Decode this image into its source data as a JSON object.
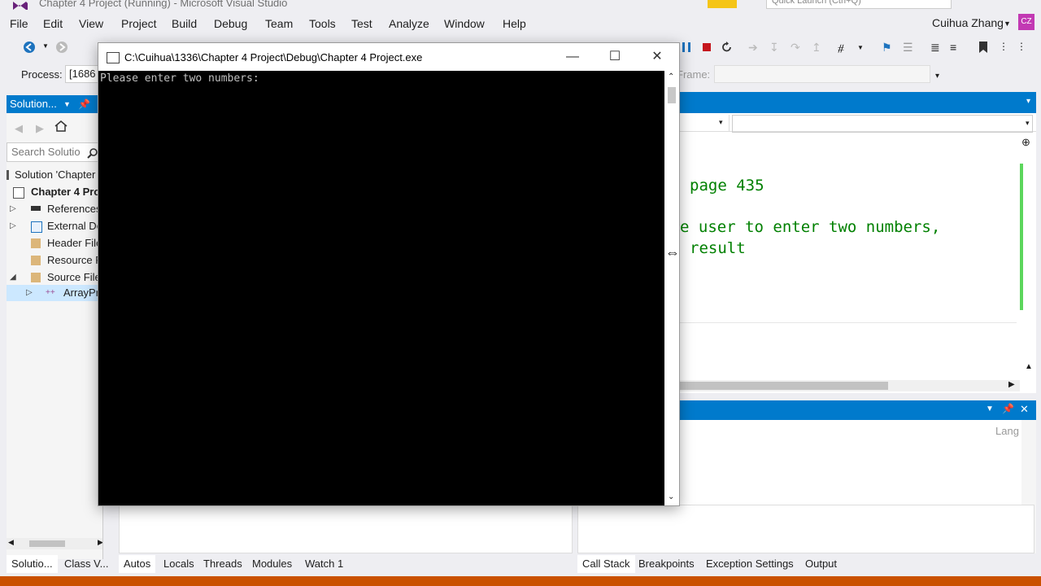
{
  "app": {
    "title": "Chapter 4 Project (Running) - Microsoft Visual Studio",
    "quick_launch_placeholder": "Quick Launch (Ctrl+Q)"
  },
  "menu": {
    "items": [
      "File",
      "Edit",
      "View",
      "Project",
      "Build",
      "Debug",
      "Team",
      "Tools",
      "Test",
      "Analyze",
      "Window",
      "Help"
    ]
  },
  "account": {
    "user_name": "Cuihua Zhang",
    "initials": "CZ"
  },
  "debug_location": {
    "process_label": "Process:",
    "process_value": "[1686",
    "stack_frame_label": "Frame:"
  },
  "solution_explorer": {
    "header_title": "Solution...",
    "search_placeholder": "Search Solutio",
    "tree": [
      {
        "label": "Solution 'Chapter",
        "icon": "solution-icon",
        "expanded": null,
        "selected": false
      },
      {
        "label": "Chapter 4 Pro",
        "icon": "project-icon",
        "expanded": null,
        "selected": false
      },
      {
        "label": "References",
        "icon": "references-icon",
        "expanded": false,
        "selected": false
      },
      {
        "label": "External De",
        "icon": "external-deps-icon",
        "expanded": false,
        "selected": false
      },
      {
        "label": "Header File",
        "icon": "folder-icon",
        "expanded": null,
        "selected": false
      },
      {
        "label": "Resource F",
        "icon": "folder-icon",
        "expanded": null,
        "selected": false
      },
      {
        "label": "Source File",
        "icon": "folder-icon",
        "expanded": true,
        "selected": false
      },
      {
        "label": "ArrayPr",
        "icon": "cpp-file-icon",
        "expanded": false,
        "selected": true
      }
    ]
  },
  "editor": {
    "code_lines": [
      "page 435",
      "e user to enter two numbers,",
      "result"
    ]
  },
  "console": {
    "title": "C:\\Cuihua\\1336\\Chapter 4 Project\\Debug\\Chapter 4 Project.exe",
    "output": "Please enter two numbers:",
    "minimize_glyph": "—",
    "maximize_glyph": "☐",
    "close_glyph": "✕"
  },
  "right_panel": {
    "column_label": "Lang"
  },
  "bottom_tabs_left": [
    {
      "label": "Solutio...",
      "active": true
    },
    {
      "label": "Class V...",
      "active": false
    }
  ],
  "bottom_tabs_debug": [
    {
      "label": "Autos",
      "active": true
    },
    {
      "label": "Locals",
      "active": false
    },
    {
      "label": "Threads",
      "active": false
    },
    {
      "label": "Modules",
      "active": false
    },
    {
      "label": "Watch 1",
      "active": false
    }
  ],
  "bottom_tabs_right": [
    {
      "label": "Call Stack",
      "active": true
    },
    {
      "label": "Breakpoints",
      "active": false
    },
    {
      "label": "Exception Settings",
      "active": false
    },
    {
      "label": "Output",
      "active": false
    }
  ],
  "colors": {
    "accent": "#007acc",
    "status_bar_debugging": "#ca5100",
    "comment_green": "#008000",
    "console_bg": "#000000",
    "console_text": "#c0c0c0"
  }
}
